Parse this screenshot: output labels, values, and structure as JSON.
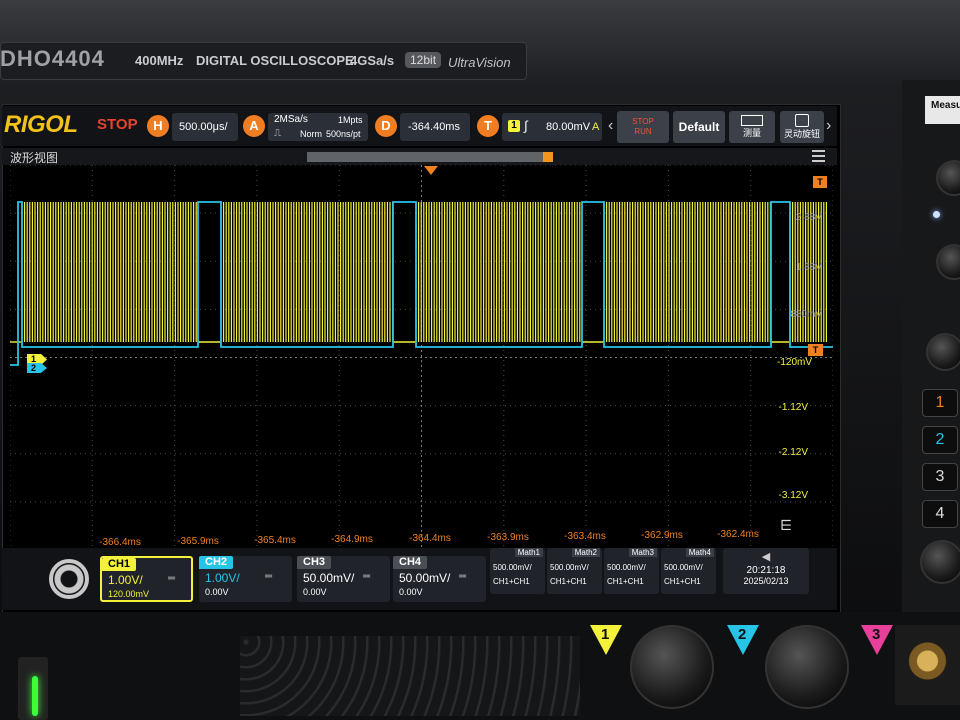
{
  "device": {
    "model": "DHO4404",
    "bandwidth": "400MHz",
    "type": "DIGITAL OSCILLOSCOPE",
    "sample_rate": "4GSa/s",
    "bits": "12bit",
    "tech": "UltraVision"
  },
  "topbar": {
    "logo": "RIGOL",
    "state": "STOP",
    "h_label": "H",
    "timebase": "500.00μs/",
    "a_label": "A",
    "acq_rate": "2MSa/s",
    "acq_depth": "1Mpts",
    "acq_mode": "Norm",
    "acq_res": "500ns/pt",
    "d_label": "D",
    "delay": "-364.40ms",
    "t_label": "T",
    "trig_source": "1",
    "trig_level": "80.00mV",
    "trig_mode": "A",
    "stop_run_top": "STOP",
    "stop_run_bottom": "RUN",
    "default_label": "Default",
    "measure_label": "测量",
    "auto_label": "灵动旋钮"
  },
  "subheader": {
    "title": "波形视图"
  },
  "axis": {
    "right_labels": [
      "2.88V",
      "1.88V",
      "880mV",
      "-120mV",
      "-1.12V",
      "-2.12V",
      "-3.12V"
    ],
    "time_labels": [
      "-366.4ms",
      "-365.9ms",
      "-365.4ms",
      "-364.9ms",
      "-364.4ms",
      "-363.9ms",
      "-363.4ms",
      "-362.9ms",
      "-362.4ms"
    ]
  },
  "markers": {
    "ch1": "1",
    "ch2": "2",
    "trig_right": "T",
    "trig_top": "T"
  },
  "channels": [
    {
      "name": "CH1",
      "scale": "1.00V/",
      "offset": "120.00mV",
      "color": "#f3f13a",
      "active": true
    },
    {
      "name": "CH2",
      "scale": "1.00V/",
      "offset": "0.00V",
      "color": "#27c4e8",
      "active": false
    },
    {
      "name": "CH3",
      "scale": "50.00mV/",
      "offset": "0.00V",
      "color": "#ffffff",
      "active": false
    },
    {
      "name": "CH4",
      "scale": "50.00mV/",
      "offset": "0.00V",
      "color": "#ffffff",
      "active": false
    }
  ],
  "math": [
    {
      "name": "Math1",
      "value": "500.00mV/",
      "formula": "CH1+CH1"
    },
    {
      "name": "Math2",
      "value": "500.00mV/",
      "formula": "CH1+CH1"
    },
    {
      "name": "Math3",
      "value": "500.00mV/",
      "formula": "CH1+CH1"
    },
    {
      "name": "Math4",
      "value": "500.00mV/",
      "formula": "CH1+CH1"
    }
  ],
  "clock": {
    "time": "20:21:18",
    "date": "2025/02/13"
  },
  "side": {
    "measure": "Measu",
    "keys": [
      "1",
      "2",
      "3",
      "4"
    ]
  },
  "hardware": {
    "inputs": [
      "1",
      "2",
      "3"
    ]
  },
  "colors": {
    "ch1": "#f3f13a",
    "ch2": "#27c4e8",
    "orange": "#f08020",
    "stop": "#e4432c"
  }
}
